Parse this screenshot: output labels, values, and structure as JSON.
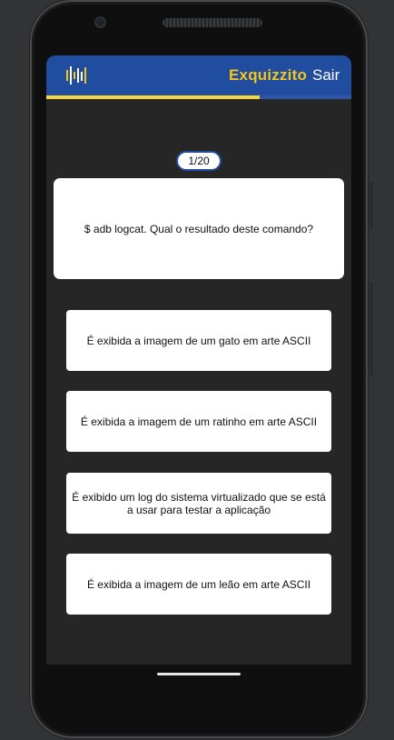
{
  "header": {
    "title": "Exquizzito",
    "exit_label": "Sair",
    "logo_icon": "app-logo-icon",
    "brand_color": "#214da0",
    "accent_color": "#f5c518"
  },
  "progress": {
    "fraction": 0.7
  },
  "quiz": {
    "counter": "1/20",
    "question": "$ adb logcat. Qual o resultado deste comando?",
    "answers": [
      "É exibida a imagem de um gato em arte ASCII",
      "É exibida a imagem de um ratinho em arte ASCII",
      "É exibido um log do sistema virtualizado que se está a usar para testar a aplicação",
      "É exibida a imagem de um leão em arte ASCII"
    ]
  }
}
